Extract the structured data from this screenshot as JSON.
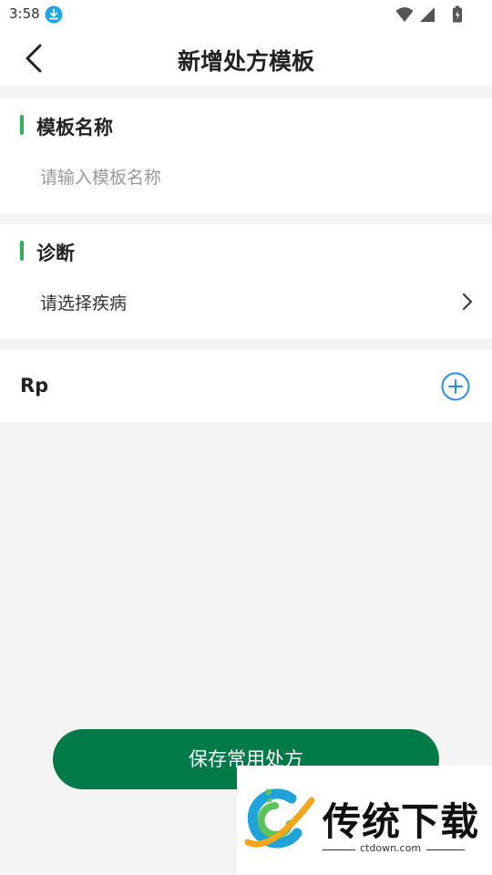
{
  "status": {
    "time": "3:58",
    "icons": [
      "download-icon",
      "wifi-icon",
      "signal-icon",
      "battery-icon"
    ]
  },
  "header": {
    "title": "新增处方模板",
    "back_icon": "chevron-left-icon"
  },
  "template_name": {
    "label": "模板名称",
    "value": "",
    "placeholder": "请输入模板名称"
  },
  "diagnosis": {
    "label": "诊断",
    "select_text": "请选择疾病",
    "icon": "chevron-right-icon"
  },
  "rp": {
    "label": "Rp",
    "add_icon": "plus-circle-icon"
  },
  "save_button": {
    "label": "保存常用处方"
  },
  "watermark": {
    "brand": "传统下载",
    "url": "ctdown.com"
  },
  "colors": {
    "accent_green": "#2fb15c",
    "button_green": "#007a47",
    "add_blue": "#2c8ee8",
    "background": "#f4f4f4"
  }
}
